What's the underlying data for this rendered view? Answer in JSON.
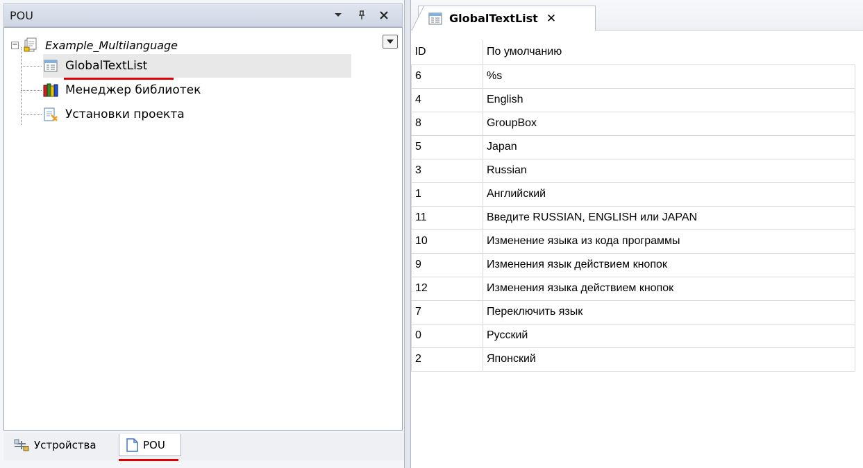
{
  "pou_panel": {
    "title": "POU",
    "header_buttons": [
      "chevron-down-icon",
      "pin-icon",
      "close-icon"
    ],
    "tree": {
      "root": {
        "label": "Example_Multilanguage",
        "expander": "−"
      },
      "items": [
        {
          "label": "GlobalTextList",
          "icon": "text-list-icon",
          "selected": true
        },
        {
          "label": "Менеджер библиотек",
          "icon": "library-books-icon"
        },
        {
          "label": "Установки проекта",
          "icon": "project-settings-icon"
        }
      ]
    },
    "bottom_tabs": [
      {
        "label": "Устройства",
        "icon": "devices-icon",
        "active": false
      },
      {
        "label": "POU",
        "icon": "pou-icon",
        "active": true
      }
    ]
  },
  "editor": {
    "tab": {
      "label": "GlobalTextList",
      "close": "✕"
    },
    "table": {
      "columns": [
        "ID",
        "По умолчанию"
      ],
      "rows": [
        [
          "6",
          "%s"
        ],
        [
          "4",
          "English"
        ],
        [
          "8",
          "GroupBox"
        ],
        [
          "5",
          "Japan"
        ],
        [
          "3",
          "Russian"
        ],
        [
          "1",
          "Английский"
        ],
        [
          "11",
          "Введите RUSSIAN, ENGLISH или JAPAN"
        ],
        [
          "10",
          "Изменение языка из кода программы"
        ],
        [
          "9",
          "Изменения язык действием кнопок"
        ],
        [
          "12",
          "Изменения языка действием кнопок"
        ],
        [
          "7",
          "Переключить язык"
        ],
        [
          "0",
          "Русский"
        ],
        [
          "2",
          "Японский"
        ]
      ]
    }
  },
  "colors": {
    "highlight_underline": "#e00000",
    "selection_background": "#e8e8e8",
    "panel_header": "#cfd6e4"
  }
}
